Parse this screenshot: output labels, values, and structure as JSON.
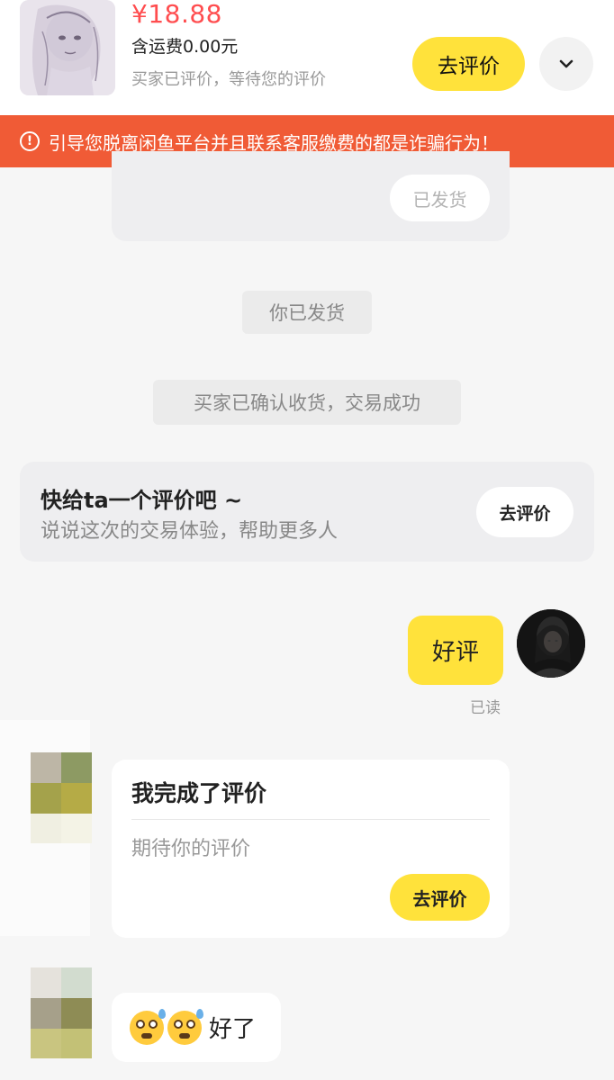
{
  "header": {
    "price": "¥18.88",
    "shipping": "含运费0.00元",
    "order_status": "买家已评价，等待您的评价",
    "review_button": "去评价"
  },
  "warning": {
    "text": "引导您脱离闲鱼平台并且联系客服缴费的都是诈骗行为！",
    "icon": "alert-circle-icon"
  },
  "messages": {
    "shipped_chip": "已发货",
    "system_shipped": "你已发货",
    "system_confirmed": "买家已确认收货，交易成功",
    "prompt_card": {
      "title": "快给ta一个评价吧 ~",
      "subtitle": "说说这次的交易体验，帮助更多人",
      "button": "去评价"
    },
    "my_message": "好评",
    "read_status": "已读",
    "review_card": {
      "title": "我完成了评价",
      "subtitle": "期待你的评价",
      "button": "去评价"
    },
    "peer_reply": {
      "emojis": "flushed-sweat-emoji x2",
      "text": "好了"
    }
  },
  "colors": {
    "accent_yellow": "#ffe23b",
    "price_red": "#ff4d4f",
    "warning_orange": "#f05b36"
  }
}
